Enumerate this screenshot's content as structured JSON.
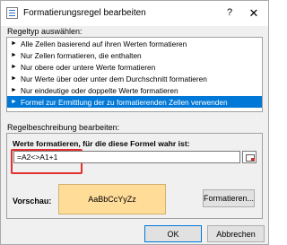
{
  "window": {
    "title": "Formatierungsregel bearbeiten",
    "help_label": "?",
    "close_label": "✕"
  },
  "rule_type": {
    "label": "Regeltyp auswählen:",
    "items": [
      {
        "label": "Alle Zellen basierend auf ihren Werten formatieren",
        "selected": false
      },
      {
        "label": "Nur Zellen formatieren, die enthalten",
        "selected": false
      },
      {
        "label": "Nur obere oder untere Werte formatieren",
        "selected": false
      },
      {
        "label": "Nur Werte über oder unter dem Durchschnitt formatieren",
        "selected": false
      },
      {
        "label": "Nur eindeutige oder doppelte Werte formatieren",
        "selected": false
      },
      {
        "label": "Formel zur Ermittlung der zu formatierenden Zellen verwenden",
        "selected": true
      }
    ]
  },
  "rule_description": {
    "label": "Regelbeschreibung bearbeiten:",
    "formula_label": "Werte formatieren, für die diese Formel wahr ist:",
    "formula_value": "=A2<>A1+1",
    "preview_label": "Vorschau:",
    "preview_text": "AaBbCcYyZz",
    "preview_color": "#ffdd99",
    "format_button": "Formatieren..."
  },
  "buttons": {
    "ok": "OK",
    "cancel": "Abbrechen"
  },
  "colors": {
    "selection": "#0078d7",
    "highlight": "#e03030"
  }
}
